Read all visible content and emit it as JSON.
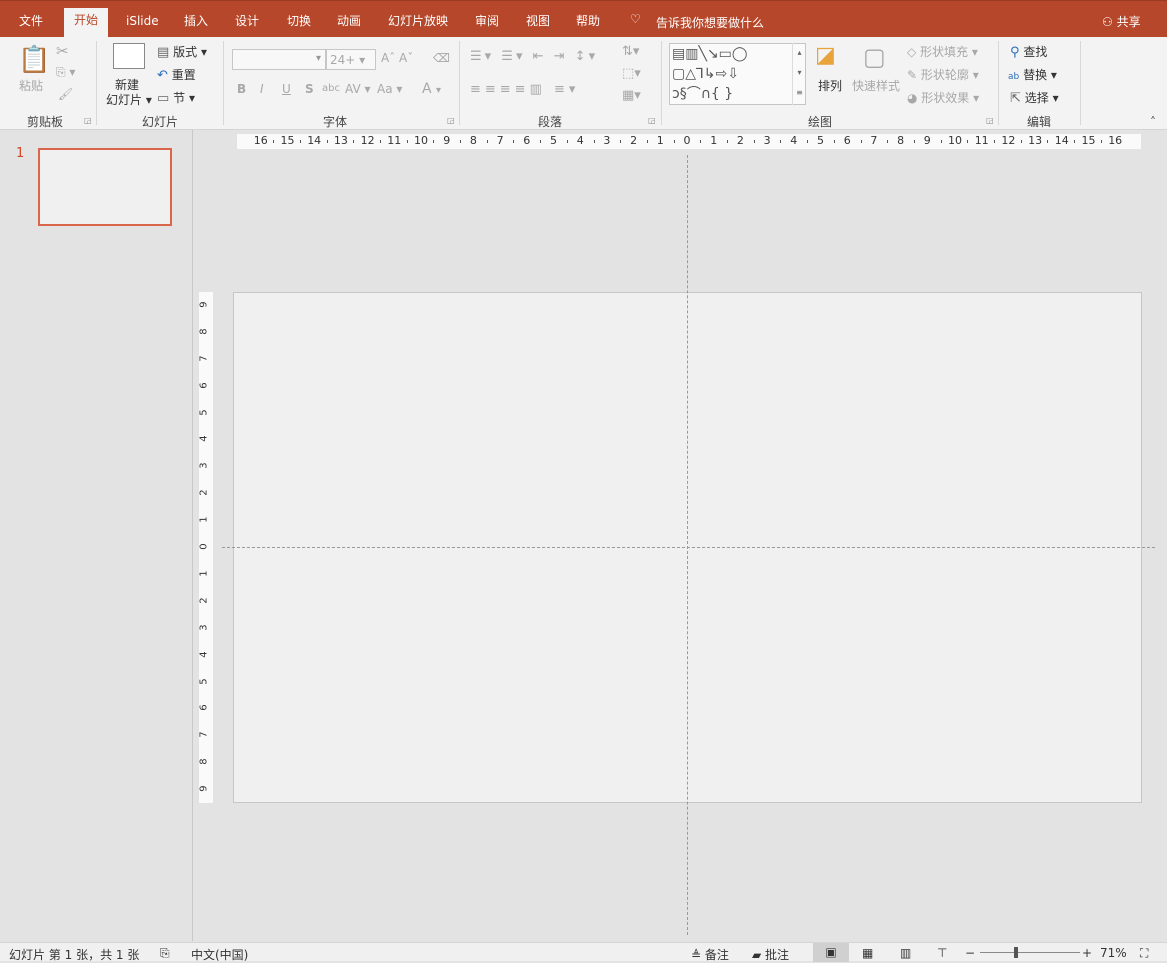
{
  "tabs": [
    "文件",
    "开始",
    "iSlide",
    "插入",
    "设计",
    "切换",
    "动画",
    "幻灯片放映",
    "审阅",
    "视图",
    "帮助"
  ],
  "tell_me": "告诉我你想要做什么",
  "share": "共享",
  "ribbon": {
    "clipboard": {
      "label": "剪贴板",
      "paste": "粘贴"
    },
    "slides": {
      "label": "幻灯片",
      "new_slide_1": "新建",
      "new_slide_2": "幻灯片",
      "layout": "版式",
      "reset": "重置",
      "section": "节"
    },
    "font": {
      "label": "字体",
      "font_name": "",
      "font_size": "24+",
      "bold": "B",
      "italic": "I",
      "underline": "U",
      "shadow": "S",
      "strike": "abc",
      "spacing": "AV",
      "case": "Aa",
      "color": "A"
    },
    "paragraph": {
      "label": "段落"
    },
    "drawing": {
      "label": "绘图",
      "arrange": "排列",
      "quick_styles": "快速样式",
      "fill": "形状填充",
      "outline": "形状轮廓",
      "effects": "形状效果"
    },
    "editing": {
      "label": "编辑",
      "find": "查找",
      "replace": "替换",
      "select": "选择"
    }
  },
  "slide_number": "1",
  "ruler_h": [
    "16",
    "15",
    "14",
    "13",
    "12",
    "11",
    "10",
    "9",
    "8",
    "7",
    "6",
    "5",
    "4",
    "3",
    "2",
    "1",
    "0",
    "1",
    "2",
    "3",
    "4",
    "5",
    "6",
    "7",
    "8",
    "9",
    "10",
    "11",
    "12",
    "13",
    "14",
    "15",
    "16"
  ],
  "ruler_v": [
    "9",
    "8",
    "7",
    "6",
    "5",
    "4",
    "3",
    "2",
    "1",
    "0",
    "1",
    "2",
    "3",
    "4",
    "5",
    "6",
    "7",
    "8",
    "9"
  ],
  "status": {
    "slide_info": "幻灯片 第 1 张，共 1 张",
    "language": "中文(中国)",
    "notes": "备注",
    "comments": "批注",
    "zoom": "71%",
    "zoom_value": 71
  },
  "colors": {
    "accent": "#b7472a"
  }
}
